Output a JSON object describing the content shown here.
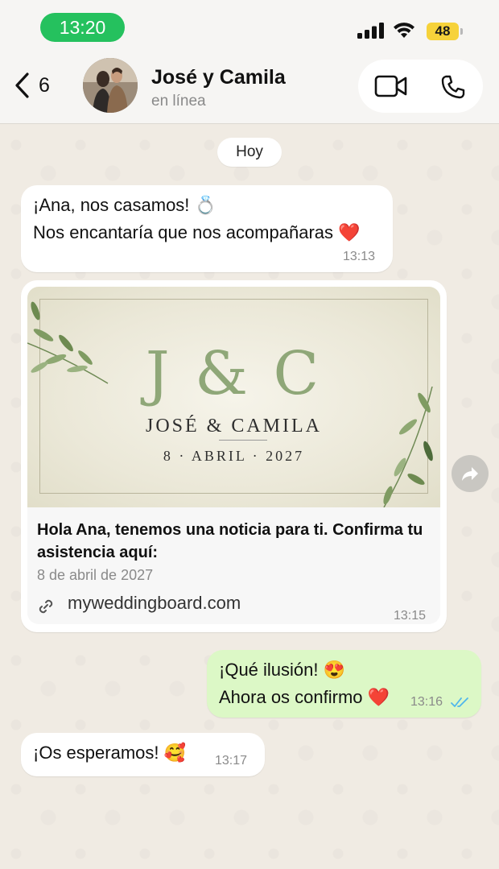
{
  "status_bar": {
    "time": "13:20",
    "battery": "48"
  },
  "header": {
    "back_count": "6",
    "contact_name": "José y Camila",
    "contact_status": "en línea"
  },
  "date_chip": "Hoy",
  "messages": [
    {
      "direction": "in",
      "lines": [
        "¡Ana, nos casamos! 💍",
        "Nos encantaría que nos acompañaras ❤️"
      ],
      "time": "13:13"
    },
    {
      "direction": "in",
      "type": "link_preview",
      "image": {
        "monogram": "J & C",
        "names": "JOSÉ & CAMILA",
        "date": "8 · ABRIL · 2027"
      },
      "title": "Hola Ana, tenemos una noticia para ti. Confirma tu asistencia aquí:",
      "subtitle": "8 de abril de 2027",
      "link": "myweddingboard.com",
      "time": "13:15"
    },
    {
      "direction": "out",
      "lines": [
        "¡Qué ilusión! 😍",
        "Ahora os confirmo ❤️"
      ],
      "time": "13:16",
      "read": true
    },
    {
      "direction": "in",
      "lines": [
        "¡Os esperamos! 🥰"
      ],
      "time": "13:17"
    }
  ],
  "colors": {
    "accent_green": "#25c15e",
    "outgoing_bubble": "#dcf8c6",
    "read_ticks": "#4fb6ec",
    "monogram": "#8fa778"
  }
}
